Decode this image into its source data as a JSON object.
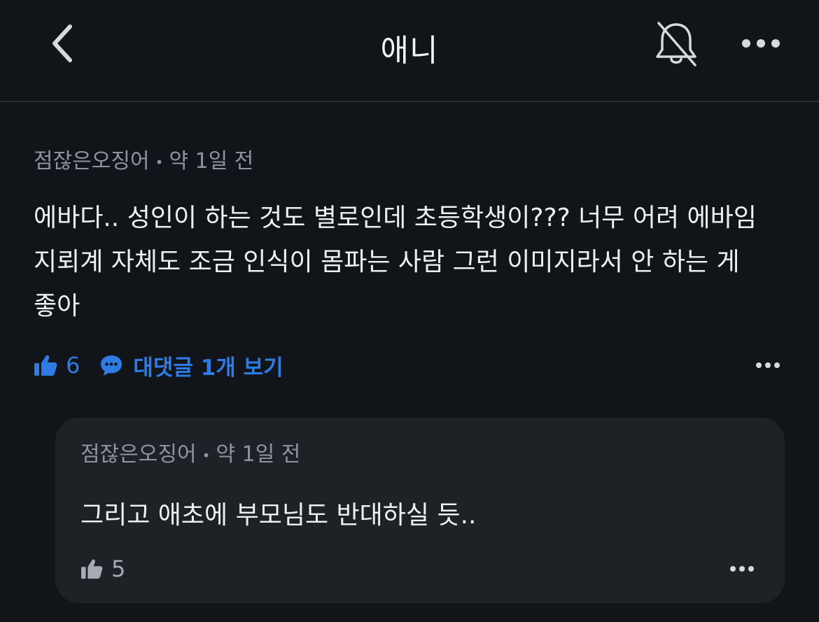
{
  "header": {
    "title": "애니",
    "back_icon": "chevron-left-icon",
    "bell_icon": "bell-off-icon",
    "more_icon": "more-horizontal-icon"
  },
  "comment": {
    "author": "점잖은오징어",
    "separator": "•",
    "time": "약 1일 전",
    "text": "에바다.. 성인이 하는 것도 별로인데 초등학생이??? 너무 어려 에바임 지뢰계 자체도 조금 인식이 몸파는 사람 그런 이미지라서 안 하는 게 좋아",
    "likes": "6",
    "replies_label": "대댓글 1개 보기"
  },
  "reply": {
    "author": "점잖은오징어",
    "separator": "•",
    "time": "약 1일 전",
    "text": "그리고 애초에 부모님도 반대하실 듯..",
    "likes": "5"
  },
  "colors": {
    "background": "#111418",
    "card": "#1e2126",
    "accent": "#2d7be5",
    "muted": "#8f959c"
  }
}
